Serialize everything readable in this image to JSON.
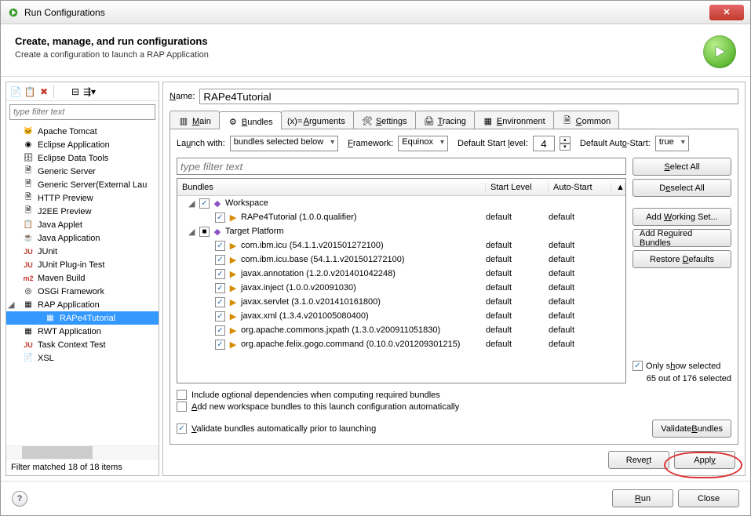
{
  "window": {
    "title": "Run Configurations"
  },
  "header": {
    "title": "Create, manage, and run configurations",
    "subtitle": "Create a configuration to launch a RAP Application"
  },
  "left": {
    "filter_placeholder": "type filter text",
    "items": [
      {
        "label": "Apache Tomcat",
        "icon": "cat"
      },
      {
        "label": "Eclipse Application",
        "icon": "eclipse"
      },
      {
        "label": "Eclipse Data Tools",
        "icon": "db"
      },
      {
        "label": "Generic Server",
        "icon": "server"
      },
      {
        "label": "Generic Server(External Lau",
        "icon": "server"
      },
      {
        "label": "HTTP Preview",
        "icon": "server"
      },
      {
        "label": "J2EE Preview",
        "icon": "server"
      },
      {
        "label": "Java Applet",
        "icon": "applet"
      },
      {
        "label": "Java Application",
        "icon": "java"
      },
      {
        "label": "JUnit",
        "icon": "junit"
      },
      {
        "label": "JUnit Plug-in Test",
        "icon": "junit"
      },
      {
        "label": "Maven Build",
        "icon": "maven"
      },
      {
        "label": "OSGi Framework",
        "icon": "osgi"
      },
      {
        "label": "RAP Application",
        "icon": "rap",
        "expanded": true,
        "children": [
          {
            "label": "RAPe4Tutorial"
          }
        ]
      },
      {
        "label": "RWT Application",
        "icon": "rwt"
      },
      {
        "label": "Task Context Test",
        "icon": "task"
      },
      {
        "label": "XSL",
        "icon": "xsl"
      }
    ],
    "status": "Filter matched 18 of 18 items"
  },
  "name": {
    "label": "Name:",
    "value": "RAPe4Tutorial"
  },
  "tabs": [
    {
      "label": "Main"
    },
    {
      "label": "Bundles",
      "active": true
    },
    {
      "label": "Arguments"
    },
    {
      "label": "Settings"
    },
    {
      "label": "Tracing"
    },
    {
      "label": "Environment"
    },
    {
      "label": "Common"
    }
  ],
  "launch": {
    "label": "Launch with:",
    "value": "bundles selected below",
    "frameworkLabel": "Framework:",
    "frameworkValue": "Equinox",
    "startLabel": "Default Start level:",
    "startValue": "4",
    "autoLabel": "Default Auto-Start:",
    "autoValue": "true"
  },
  "bundles": {
    "filter_placeholder": "type filter text",
    "cols": {
      "b": "Bundles",
      "s": "Start Level",
      "a": "Auto-Start"
    },
    "rows": [
      {
        "indent": 0,
        "expander": "▾",
        "check": true,
        "icon": "◆",
        "label": "Workspace",
        "sl": "",
        "as": ""
      },
      {
        "indent": 1,
        "check": true,
        "icon": "▶",
        "label": "RAPe4Tutorial (1.0.0.qualifier)",
        "sl": "default",
        "as": "default"
      },
      {
        "indent": 0,
        "expander": "▾",
        "check": "mixed",
        "icon": "◆",
        "label": "Target Platform",
        "sl": "",
        "as": ""
      },
      {
        "indent": 1,
        "check": true,
        "icon": "▶",
        "label": "com.ibm.icu (54.1.1.v201501272100)",
        "sl": "default",
        "as": "default"
      },
      {
        "indent": 1,
        "check": true,
        "icon": "▶",
        "label": "com.ibm.icu.base (54.1.1.v201501272100)",
        "sl": "default",
        "as": "default"
      },
      {
        "indent": 1,
        "check": true,
        "icon": "▶",
        "label": "javax.annotation (1.2.0.v201401042248)",
        "sl": "default",
        "as": "default"
      },
      {
        "indent": 1,
        "check": true,
        "icon": "▶",
        "label": "javax.inject (1.0.0.v20091030)",
        "sl": "default",
        "as": "default"
      },
      {
        "indent": 1,
        "check": true,
        "icon": "▶",
        "label": "javax.servlet (3.1.0.v201410161800)",
        "sl": "default",
        "as": "default"
      },
      {
        "indent": 1,
        "check": true,
        "icon": "▶",
        "label": "javax.xml (1.3.4.v201005080400)",
        "sl": "default",
        "as": "default"
      },
      {
        "indent": 1,
        "check": true,
        "icon": "▶",
        "label": "org.apache.commons.jxpath (1.3.0.v200911051830)",
        "sl": "default",
        "as": "default"
      },
      {
        "indent": 1,
        "check": true,
        "icon": "▶",
        "label": "org.apache.felix.gogo.command (0.10.0.v201209301215)",
        "sl": "default",
        "as": "default"
      }
    ]
  },
  "sidebtns": {
    "selectAll": "Select All",
    "deselectAll": "Deselect All",
    "addWorking": "Add Working Set...",
    "addRequired": "Add Required Bundles",
    "restore": "Restore Defaults",
    "onlyShow": "Only show selected",
    "count": "65 out of 176 selected"
  },
  "checks": {
    "c1": "Include optional dependencies when computing required bundles",
    "c2": "Add new workspace bundles to this launch configuration automatically",
    "c3": "Validate bundles automatically prior to launching",
    "validateBtn": "Validate Bundles"
  },
  "buttons": {
    "revert": "Revert",
    "apply": "Apply",
    "run": "Run",
    "close": "Close"
  }
}
